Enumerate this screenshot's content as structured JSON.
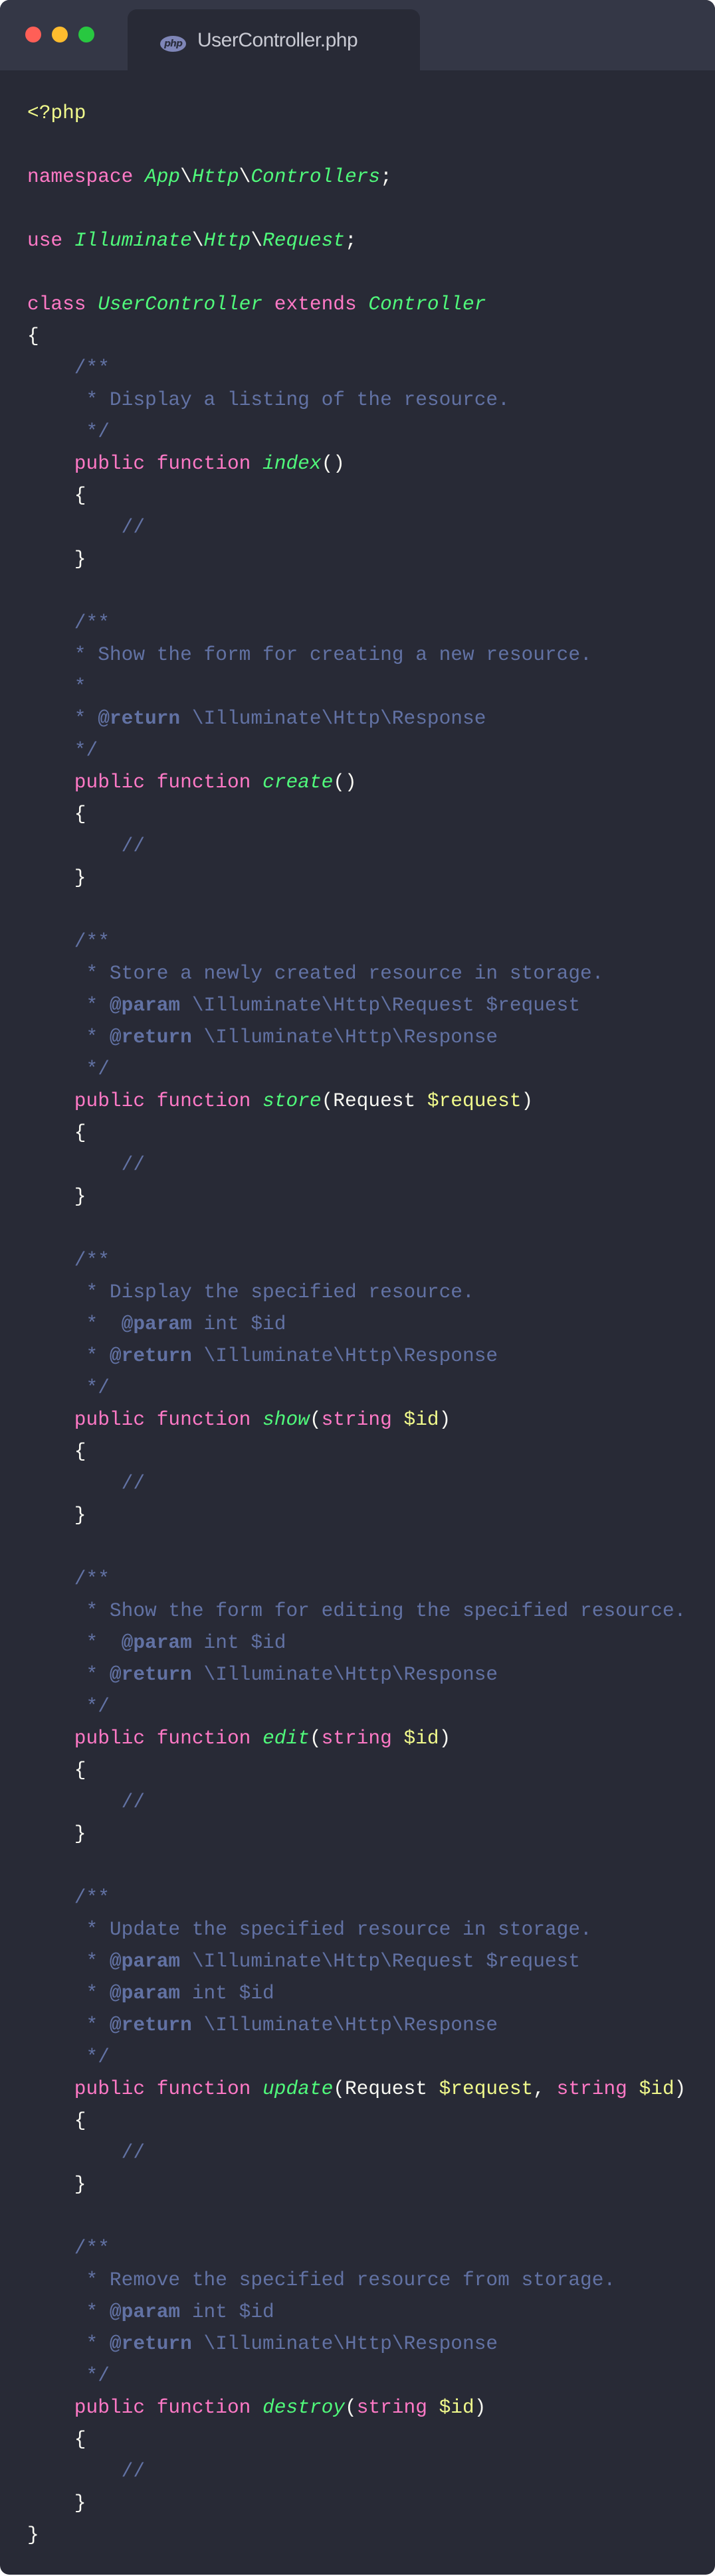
{
  "window": {
    "tab_title": "UserController.php",
    "tab_icon": "php-file-icon",
    "tab_icon_text": "php",
    "colors": {
      "background": "#282a36",
      "titlebar": "#343746",
      "keyword": "#ff79c6",
      "class": "#50fa7b",
      "variable": "#f1fa8c",
      "comment": "#6272a4",
      "text": "#f8f8f2"
    }
  },
  "code": [
    [
      [
        "php",
        "<?php"
      ]
    ],
    [],
    [
      [
        "kw",
        "namespace "
      ],
      [
        "cls",
        "App"
      ],
      [
        "plain",
        "\\"
      ],
      [
        "cls",
        "Http"
      ],
      [
        "plain",
        "\\"
      ],
      [
        "cls",
        "Controllers"
      ],
      [
        "plain",
        ";"
      ]
    ],
    [],
    [
      [
        "kw",
        "use "
      ],
      [
        "cls",
        "Illuminate"
      ],
      [
        "plain",
        "\\"
      ],
      [
        "cls",
        "Http"
      ],
      [
        "plain",
        "\\"
      ],
      [
        "cls",
        "Request"
      ],
      [
        "plain",
        ";"
      ]
    ],
    [],
    [
      [
        "kw",
        "class "
      ],
      [
        "cls",
        "UserController"
      ],
      [
        "kw",
        " extends "
      ],
      [
        "cls",
        "Controller"
      ]
    ],
    [
      [
        "plain",
        "{"
      ]
    ],
    [
      [
        "cm",
        "    /**"
      ]
    ],
    [
      [
        "cm",
        "     * Display a listing of the resource."
      ]
    ],
    [
      [
        "cm",
        "     */"
      ]
    ],
    [
      [
        "kw",
        "    public function "
      ],
      [
        "fn",
        "index"
      ],
      [
        "plain",
        "()"
      ]
    ],
    [
      [
        "plain",
        "    {"
      ]
    ],
    [
      [
        "cm",
        "        //"
      ]
    ],
    [
      [
        "plain",
        "    }"
      ]
    ],
    [],
    [
      [
        "cm",
        "    /**"
      ]
    ],
    [
      [
        "cm",
        "    * Show the form for creating a new resource."
      ]
    ],
    [
      [
        "cm",
        "    *"
      ]
    ],
    [
      [
        "cm",
        "    * "
      ],
      [
        "tag",
        "@return"
      ],
      [
        "cm",
        " \\Illuminate\\Http\\Response"
      ]
    ],
    [
      [
        "cm",
        "    */"
      ]
    ],
    [
      [
        "kw",
        "    public function "
      ],
      [
        "fn",
        "create"
      ],
      [
        "plain",
        "()"
      ]
    ],
    [
      [
        "plain",
        "    {"
      ]
    ],
    [
      [
        "cm",
        "        //"
      ]
    ],
    [
      [
        "plain",
        "    }"
      ]
    ],
    [],
    [
      [
        "cm",
        "    /**"
      ]
    ],
    [
      [
        "cm",
        "     * Store a newly created resource in storage."
      ]
    ],
    [
      [
        "cm",
        "     * "
      ],
      [
        "tag",
        "@param"
      ],
      [
        "cm",
        " \\Illuminate\\Http\\Request $request"
      ]
    ],
    [
      [
        "cm",
        "     * "
      ],
      [
        "tag",
        "@return"
      ],
      [
        "cm",
        " \\Illuminate\\Http\\Response"
      ]
    ],
    [
      [
        "cm",
        "     */"
      ]
    ],
    [
      [
        "kw",
        "    public function "
      ],
      [
        "fn",
        "store"
      ],
      [
        "plain",
        "(Request "
      ],
      [
        "var",
        "$request"
      ],
      [
        "plain",
        ")"
      ]
    ],
    [
      [
        "plain",
        "    {"
      ]
    ],
    [
      [
        "cm",
        "        //"
      ]
    ],
    [
      [
        "plain",
        "    }"
      ]
    ],
    [],
    [
      [
        "cm",
        "    /**"
      ]
    ],
    [
      [
        "cm",
        "     * Display the specified resource."
      ]
    ],
    [
      [
        "cm",
        "     *  "
      ],
      [
        "tag",
        "@param"
      ],
      [
        "cm",
        " int $id"
      ]
    ],
    [
      [
        "cm",
        "     * "
      ],
      [
        "tag",
        "@return"
      ],
      [
        "cm",
        " \\Illuminate\\Http\\Response"
      ]
    ],
    [
      [
        "cm",
        "     */"
      ]
    ],
    [
      [
        "kw",
        "    public function "
      ],
      [
        "fn",
        "show"
      ],
      [
        "plain",
        "("
      ],
      [
        "kw",
        "string "
      ],
      [
        "var",
        "$id"
      ],
      [
        "plain",
        ")"
      ]
    ],
    [
      [
        "plain",
        "    {"
      ]
    ],
    [
      [
        "cm",
        "        //"
      ]
    ],
    [
      [
        "plain",
        "    }"
      ]
    ],
    [],
    [
      [
        "cm",
        "    /**"
      ]
    ],
    [
      [
        "cm",
        "     * Show the form for editing the specified resource."
      ]
    ],
    [
      [
        "cm",
        "     *  "
      ],
      [
        "tag",
        "@param"
      ],
      [
        "cm",
        " int $id"
      ]
    ],
    [
      [
        "cm",
        "     * "
      ],
      [
        "tag",
        "@return"
      ],
      [
        "cm",
        " \\Illuminate\\Http\\Response"
      ]
    ],
    [
      [
        "cm",
        "     */"
      ]
    ],
    [
      [
        "kw",
        "    public function "
      ],
      [
        "fn",
        "edit"
      ],
      [
        "plain",
        "("
      ],
      [
        "kw",
        "string "
      ],
      [
        "var",
        "$id"
      ],
      [
        "plain",
        ")"
      ]
    ],
    [
      [
        "plain",
        "    {"
      ]
    ],
    [
      [
        "cm",
        "        //"
      ]
    ],
    [
      [
        "plain",
        "    }"
      ]
    ],
    [],
    [
      [
        "cm",
        "    /**"
      ]
    ],
    [
      [
        "cm",
        "     * Update the specified resource in storage."
      ]
    ],
    [
      [
        "cm",
        "     * "
      ],
      [
        "tag",
        "@param"
      ],
      [
        "cm",
        " \\Illuminate\\Http\\Request $request"
      ]
    ],
    [
      [
        "cm",
        "     * "
      ],
      [
        "tag",
        "@param"
      ],
      [
        "cm",
        " int $id"
      ]
    ],
    [
      [
        "cm",
        "     * "
      ],
      [
        "tag",
        "@return"
      ],
      [
        "cm",
        " \\Illuminate\\Http\\Response"
      ]
    ],
    [
      [
        "cm",
        "     */"
      ]
    ],
    [
      [
        "kw",
        "    public function "
      ],
      [
        "fn",
        "update"
      ],
      [
        "plain",
        "(Request "
      ],
      [
        "var",
        "$request"
      ],
      [
        "plain",
        ", "
      ],
      [
        "kw",
        "string "
      ],
      [
        "var",
        "$id"
      ],
      [
        "plain",
        ")"
      ]
    ],
    [
      [
        "plain",
        "    {"
      ]
    ],
    [
      [
        "cm",
        "        //"
      ]
    ],
    [
      [
        "plain",
        "    }"
      ]
    ],
    [],
    [
      [
        "cm",
        "    /**"
      ]
    ],
    [
      [
        "cm",
        "     * Remove the specified resource from storage."
      ]
    ],
    [
      [
        "cm",
        "     * "
      ],
      [
        "tag",
        "@param"
      ],
      [
        "cm",
        " int $id"
      ]
    ],
    [
      [
        "cm",
        "     * "
      ],
      [
        "tag",
        "@return"
      ],
      [
        "cm",
        " \\Illuminate\\Http\\Response"
      ]
    ],
    [
      [
        "cm",
        "     */"
      ]
    ],
    [
      [
        "kw",
        "    public function "
      ],
      [
        "fn",
        "destroy"
      ],
      [
        "plain",
        "("
      ],
      [
        "kw",
        "string "
      ],
      [
        "var",
        "$id"
      ],
      [
        "plain",
        ")"
      ]
    ],
    [
      [
        "plain",
        "    {"
      ]
    ],
    [
      [
        "cm",
        "        //"
      ]
    ],
    [
      [
        "plain",
        "    }"
      ]
    ],
    [
      [
        "plain",
        "}"
      ]
    ]
  ]
}
